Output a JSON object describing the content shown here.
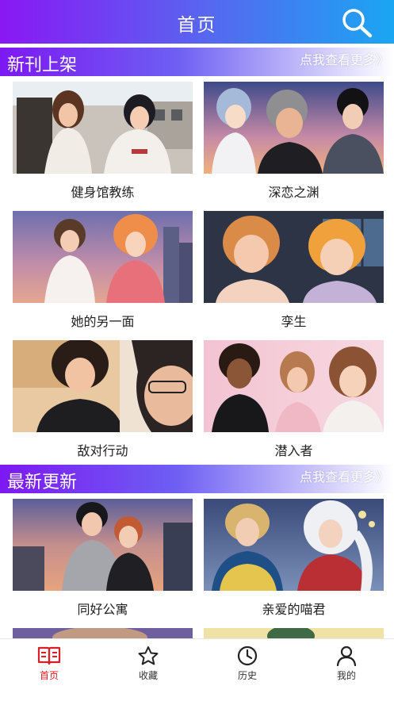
{
  "header": {
    "title": "首页"
  },
  "sections": {
    "new_releases": {
      "title": "新刊上架",
      "more": "点我查看更多》",
      "items": [
        {
          "title": "健身馆教练"
        },
        {
          "title": "深恋之渊"
        },
        {
          "title": "她的另一面"
        },
        {
          "title": "孪生"
        },
        {
          "title": "敌对行动"
        },
        {
          "title": "潜入者"
        }
      ]
    },
    "latest_updates": {
      "title": "最新更新",
      "more": "点我查看更多》",
      "items": [
        {
          "title": "同好公寓"
        },
        {
          "title": "亲爱的喵君"
        }
      ]
    }
  },
  "tabbar": {
    "items": [
      {
        "label": "首页",
        "icon": "book-icon",
        "active": true
      },
      {
        "label": "收藏",
        "icon": "star-icon",
        "active": false
      },
      {
        "label": "历史",
        "icon": "clock-icon",
        "active": false
      },
      {
        "label": "我的",
        "icon": "user-icon",
        "active": false
      }
    ]
  },
  "colors": {
    "header_gradient": [
      "#8a17f4",
      "#5a63f0",
      "#1aa6f3"
    ],
    "section_gradient": [
      "#7d18f2",
      "#6e5ff3",
      "#ffffff"
    ],
    "active_tab": "#d81e26"
  }
}
